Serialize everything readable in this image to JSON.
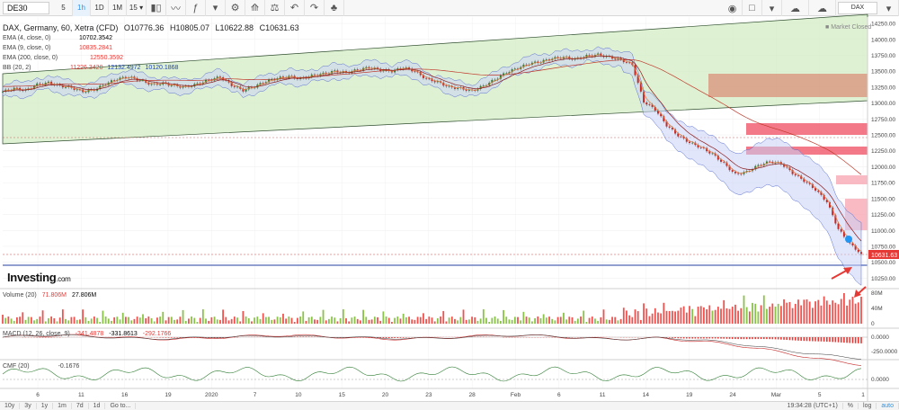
{
  "toolbar": {
    "symbol": "DE30",
    "intervals": [
      "5",
      "1h",
      "1D",
      "1M",
      "15"
    ],
    "active_interval": "1h",
    "right_symbol": "DAX"
  },
  "legend": {
    "title": "DAX, Germany, 60, Xetra (CFD)",
    "open": "O10776.36",
    "high": "H10805.07",
    "low": "L10622.88",
    "close": "C10631.63",
    "ema4_label": "EMA (4, close, 0)",
    "ema4_value": "10702.3542",
    "ema9_label": "EMA (9, close, 0)",
    "ema9_value": "10835.2841",
    "ema200_label": "EMA (200, close, 0)",
    "ema200_value": "12550.3592",
    "bb_label": "BB (20, 2)",
    "bb_upper": "11226.3420",
    "bb_mid": "12132.4972",
    "bb_lower": "10120.1868"
  },
  "market_status": "Market Closed",
  "logo": {
    "main": "Investing",
    "suffix": ".com"
  },
  "volume": {
    "label": "Volume (20)",
    "v1": "71.806M",
    "v2": "27.806M"
  },
  "macd": {
    "label": "MACD (12, 26, close, 9)",
    "v1": "-341.4878",
    "v2": "-331.8613",
    "v3": "-292.1766"
  },
  "cmf": {
    "label": "CMF (20)",
    "value": "-0.1676"
  },
  "bottom": {
    "ranges": [
      "10y",
      "3y",
      "1y",
      "1m",
      "7d",
      "1d",
      "Go to..."
    ],
    "time": "19:34:28 (UTC+1)",
    "pct": "%",
    "log": "log",
    "auto": "auto"
  },
  "colors": {
    "up": "#26a69a",
    "down": "#e53935",
    "bb_fill": "#c9d2f5",
    "channel": "#d4ecc4",
    "ema4": "#e07b39",
    "ema9": "#8b1a1a",
    "ema200": "#c0392b"
  },
  "chart_data": {
    "type": "line",
    "title": "DAX, Germany, 60, Xetra (CFD)",
    "x_tick_labels": [
      "6",
      "11",
      "16",
      "19",
      "2020",
      "7",
      "10",
      "15",
      "20",
      "23",
      "28",
      "Feb",
      "6",
      "11",
      "14",
      "19",
      "24",
      "Mar",
      "5",
      "1"
    ],
    "y_tick_labels": [
      "14250.00",
      "14000.00",
      "13750.00",
      "13500.00",
      "13250.00",
      "13000.00",
      "12750.00",
      "12500.00",
      "12250.00",
      "12000.00",
      "11750.00",
      "11500.00",
      "11250.00",
      "11000.00",
      "10750.00",
      "10500.00",
      "10250.00"
    ],
    "ylim": [
      10100,
      14350
    ],
    "last_price": "10631.63",
    "series": [
      {
        "values": [
          13180,
          13230,
          13200,
          13290,
          13320,
          13270,
          13240,
          13180,
          13210,
          13300,
          13380,
          13410,
          13360,
          13290,
          13310,
          13270,
          13250,
          13300,
          13360,
          13410,
          13280,
          13200,
          13260,
          13340,
          13390,
          13420,
          13380,
          13430,
          13460,
          13500,
          13480,
          13520,
          13560,
          13520,
          13500,
          13560,
          13500,
          13380,
          13330,
          13250,
          13230,
          13190,
          13270,
          13370,
          13480,
          13550,
          13620,
          13650,
          13700,
          13720,
          13690,
          13740,
          13760,
          13720,
          13680,
          13600,
          13020,
          12900,
          12650,
          12490,
          12380,
          12300,
          12200,
          12050,
          11880,
          11920,
          12020,
          12080,
          12050,
          11900,
          11780,
          11640,
          11450,
          11020,
          10790,
          10631.63
        ]
      }
    ],
    "volume_label": "Volume (20)",
    "volume_ticks": [
      "80M",
      "40M",
      "0"
    ],
    "macd_ticks": [
      "0.0000",
      "-250.0000"
    ],
    "cmf_ticks": [
      "0.0000"
    ]
  }
}
